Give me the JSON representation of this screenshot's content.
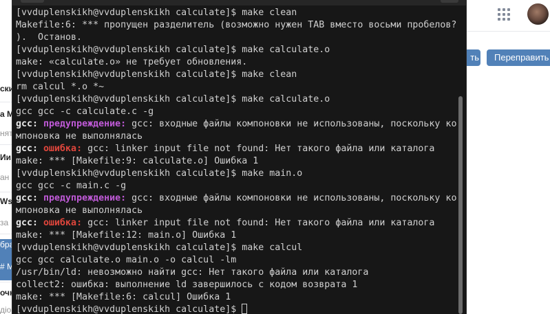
{
  "browser": {
    "left_items": [
      {
        "text": "ски",
        "style": "bold"
      },
      {
        "text": "a M",
        "style": "bold"
      },
      {
        "text": "нят",
        "style": "gray"
      },
      {
        "text": "Ии",
        "style": "bold"
      },
      {
        "text": "ан",
        "style": "gray"
      },
      {
        "text": "Ws",
        "style": "bold"
      },
      {
        "text": "за",
        "style": "gray"
      },
      {
        "text": "бра",
        "style": "blue"
      },
      {
        "text": "# M",
        "style": "blue"
      },
      {
        "text": "очн",
        "style": "bold"
      },
      {
        "text": "дiо",
        "style": "gray"
      }
    ],
    "button_partial_label": "ть",
    "button_forward_label": "Переправить",
    "apps_icon": "grid-apps-icon",
    "avatar_icon": "user-avatar"
  },
  "terminal": {
    "lines": [
      [
        {
          "t": "[vvduplenskikh@vvduplenskikh calculate]$ make clean",
          "c": ""
        }
      ],
      [
        {
          "t": "Makefile:6: *** пропущен разделитель (возможно нужен TAB вместо восьми пробелов?",
          "c": ""
        }
      ],
      [
        {
          "t": ").  Останов.",
          "c": ""
        }
      ],
      [
        {
          "t": "[vvduplenskikh@vvduplenskikh calculate]$ make calculate.o",
          "c": ""
        }
      ],
      [
        {
          "t": "make: «calculate.o» не требует обновления.",
          "c": ""
        }
      ],
      [
        {
          "t": "[vvduplenskikh@vvduplenskikh calculate]$ make clean",
          "c": ""
        }
      ],
      [
        {
          "t": "rm calcul *.o *~",
          "c": ""
        }
      ],
      [
        {
          "t": "[vvduplenskikh@vvduplenskikh calculate]$ make calculate.o",
          "c": ""
        }
      ],
      [
        {
          "t": "gcc gcc -c calculate.c -g",
          "c": ""
        }
      ],
      [
        {
          "t": "gcc: ",
          "c": "b"
        },
        {
          "t": "предупреждение: ",
          "c": "warn"
        },
        {
          "t": "gcc: входные файлы компоновки не использованы, поскольку ко",
          "c": ""
        }
      ],
      [
        {
          "t": "мпоновка не выполнялась",
          "c": ""
        }
      ],
      [
        {
          "t": "gcc: ",
          "c": "b"
        },
        {
          "t": "ошибка: ",
          "c": "err"
        },
        {
          "t": "gcc: linker input file not found: Нет такого файла или каталога",
          "c": ""
        }
      ],
      [
        {
          "t": "make: *** [Makefile:9: calculate.o] Ошибка 1",
          "c": ""
        }
      ],
      [
        {
          "t": "[vvduplenskikh@vvduplenskikh calculate]$ make main.o",
          "c": ""
        }
      ],
      [
        {
          "t": "gcc gcc -c main.c -g",
          "c": ""
        }
      ],
      [
        {
          "t": "gcc: ",
          "c": "b"
        },
        {
          "t": "предупреждение: ",
          "c": "warn"
        },
        {
          "t": "gcc: входные файлы компоновки не использованы, поскольку ко",
          "c": ""
        }
      ],
      [
        {
          "t": "мпоновка не выполнялась",
          "c": ""
        }
      ],
      [
        {
          "t": "gcc: ",
          "c": "b"
        },
        {
          "t": "ошибка: ",
          "c": "err"
        },
        {
          "t": "gcc: linker input file not found: Нет такого файла или каталога",
          "c": ""
        }
      ],
      [
        {
          "t": "make: *** [Makefile:12: main.o] Ошибка 1",
          "c": ""
        }
      ],
      [
        {
          "t": "[vvduplenskikh@vvduplenskikh calculate]$ make calcul",
          "c": ""
        }
      ],
      [
        {
          "t": "gcc gcc calculate.o main.o -o calcul -lm",
          "c": ""
        }
      ],
      [
        {
          "t": "/usr/bin/ld: невозможно найти gcc: Нет такого файла или каталога",
          "c": ""
        }
      ],
      [
        {
          "t": "collect2: ошибка: выполнение ld завершилось с кодом возврата 1",
          "c": ""
        }
      ],
      [
        {
          "t": "make: *** [Makefile:6: calcul] Ошибка 1",
          "c": ""
        }
      ],
      [
        {
          "t": "[vvduplenskikh@vvduplenskikh calculate]$ ",
          "c": ""
        }
      ]
    ],
    "colors": {
      "background": "#171717",
      "text": "#d0d0d0",
      "warning": "#c05ad8",
      "error": "#e0463c"
    }
  }
}
